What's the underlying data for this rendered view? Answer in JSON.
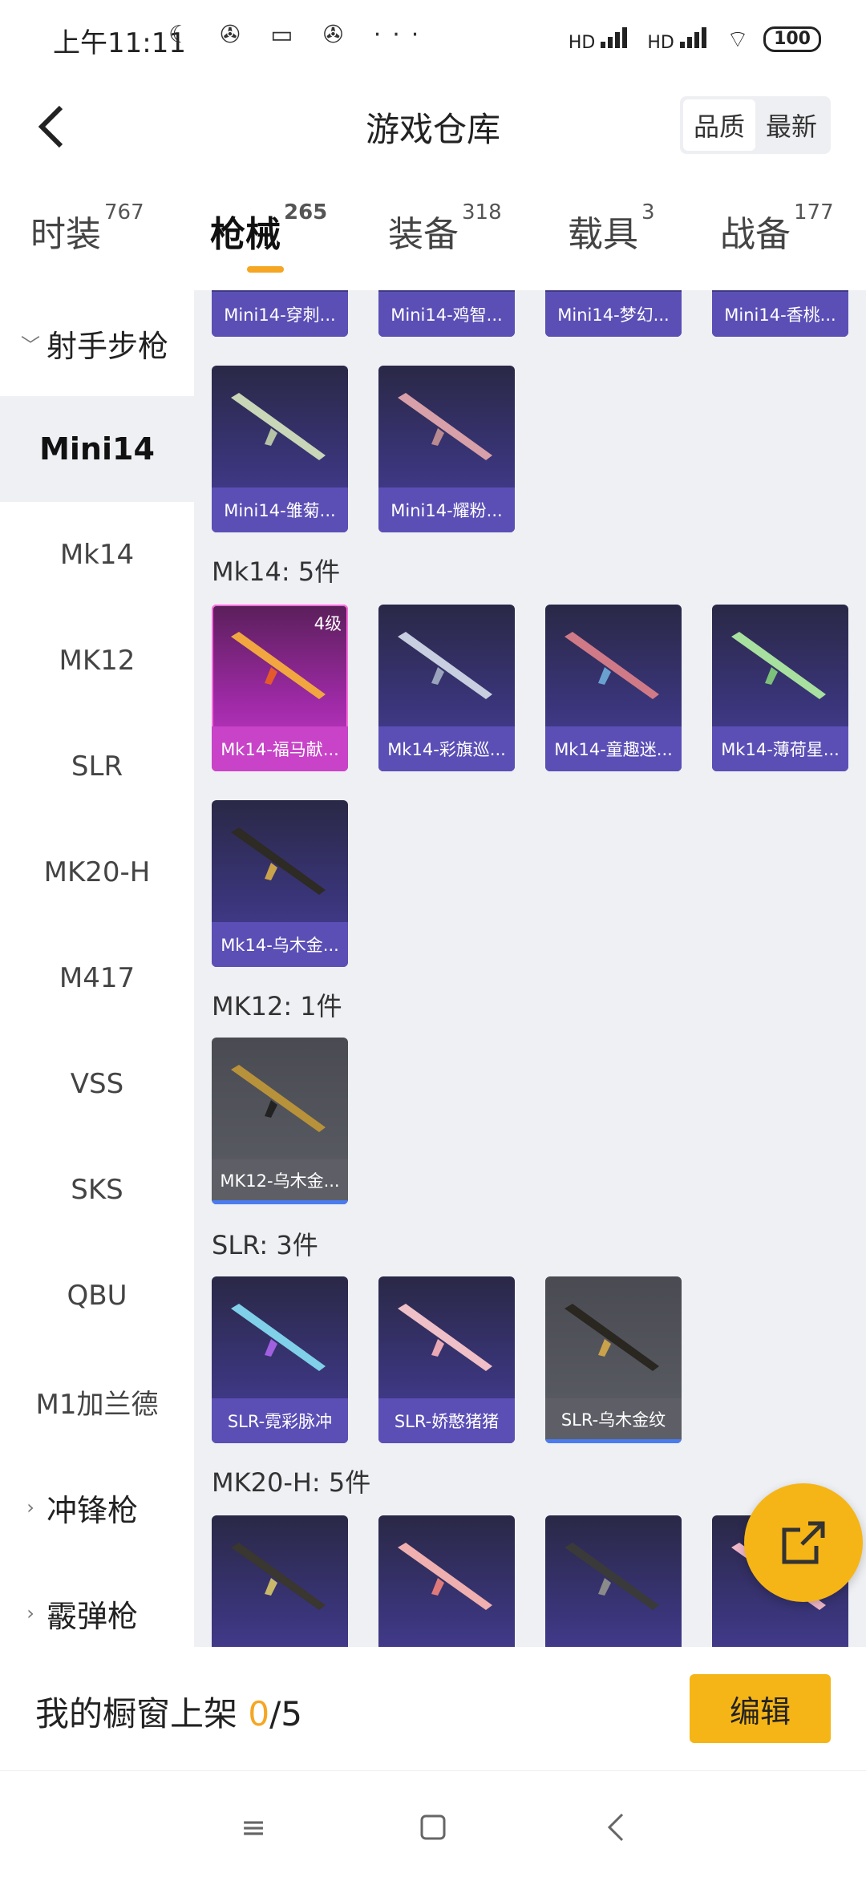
{
  "status_bar": {
    "time": "上午11:11",
    "left_icons": [
      "moon-icon",
      "wechat-icon",
      "message-icon",
      "wechat-icon",
      "more-icon"
    ],
    "hd1": "HD",
    "hd2": "HD",
    "battery": "100"
  },
  "header": {
    "title": "游戏仓库",
    "sort": [
      "品质",
      "最新"
    ],
    "active_sort": "品质"
  },
  "tabs": [
    {
      "label": "时装",
      "count": "767"
    },
    {
      "label": "枪械",
      "count": "265"
    },
    {
      "label": "装备",
      "count": "318"
    },
    {
      "label": "载具",
      "count": "3"
    },
    {
      "label": "战备",
      "count": "177"
    }
  ],
  "active_tab": "枪械",
  "sidebar": {
    "group_rifle": "射手步枪",
    "items": [
      "Mini14",
      "Mk14",
      "MK12",
      "SLR",
      "MK20-H",
      "M417",
      "VSS",
      "SKS",
      "QBU",
      "M1加兰德"
    ],
    "active_item": "Mini14",
    "group_smg": "冲锋枪",
    "group_shotgun": "霰弹枪"
  },
  "sections": {
    "mini14_top_row": [
      "Mini14-穿刺...",
      "Mini14-鸡智...",
      "Mini14-梦幻...",
      "Mini14-香桃..."
    ],
    "mini14_row2": [
      "Mini14-雏菊...",
      "Mini14-耀粉..."
    ],
    "mk14_head": "Mk14: 5件",
    "mk14": [
      "Mk14-福马献...",
      "Mk14-彩旗巡...",
      "Mk14-童趣迷...",
      "Mk14-薄荷星...",
      "Mk14-乌木金..."
    ],
    "mk14_level": "4级",
    "mk12_head": "MK12: 1件",
    "mk12": [
      "MK12-乌木金..."
    ],
    "slr_head": "SLR: 3件",
    "slr": [
      "SLR-霓彩脉冲",
      "SLR-娇憨猪猪",
      "SLR-乌木金纹"
    ],
    "mk20_head": "MK20-H: 5件"
  },
  "bottom": {
    "shelf_label": "我的橱窗上架 ",
    "shelf_count": "0",
    "shelf_total": "/5",
    "edit": "编辑"
  },
  "colors": {
    "accent": "#f6b516",
    "card_purple": "#5b4fb6",
    "card_pink": "#c843c8",
    "card_gray": "#5e5f66"
  }
}
